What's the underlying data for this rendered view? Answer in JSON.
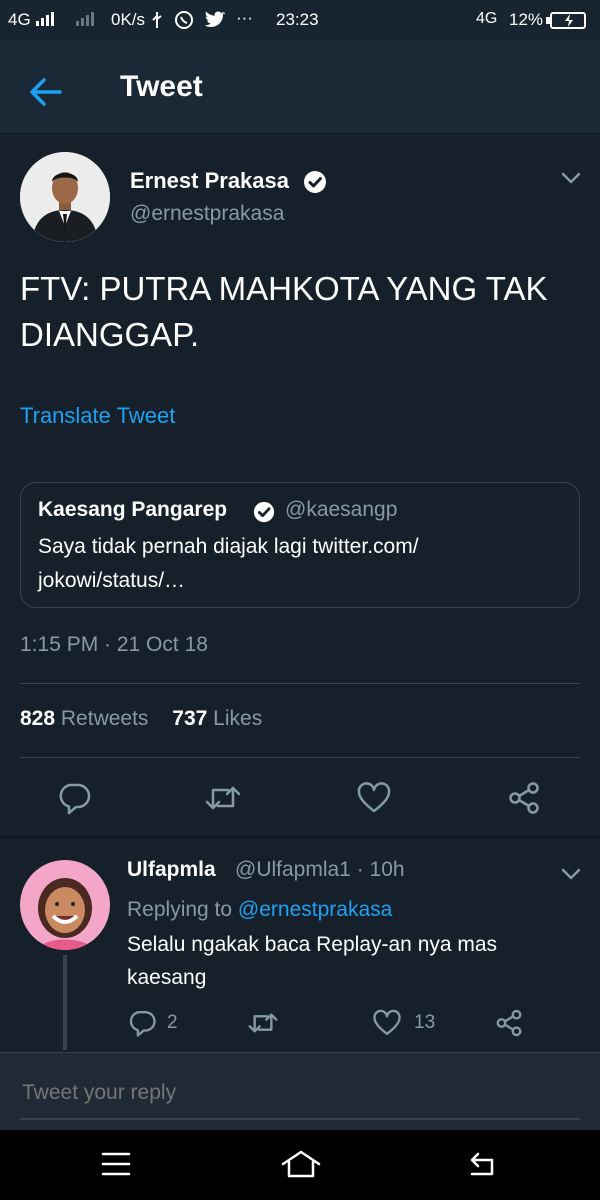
{
  "status_bar": {
    "network1": "4G",
    "network2": "4G",
    "speed": "0K/s",
    "dots": "···",
    "time": "23:23",
    "battery": "12%"
  },
  "header": {
    "title": "Tweet"
  },
  "tweet": {
    "author_name": "Ernest Prakasa",
    "author_handle": "@ernestprakasa",
    "text_line1": "FTV: PUTRA MAHKOTA YANG TAK",
    "text_line2": "DIANGGAP.",
    "translate": "Translate Tweet",
    "quote": {
      "name": "Kaesang Pangarep",
      "handle": "@kaesangp",
      "text_line1": "Saya tidak pernah diajak lagi twitter.com/",
      "text_line2": "jokowi/status/…"
    },
    "timestamp": "1:15 PM · 21 Oct 18",
    "retweets_count": "828",
    "retweets_label": "Retweets",
    "likes_count": "737",
    "likes_label": "Likes"
  },
  "reply": {
    "name": "Ulfapmla",
    "handle_time": "@Ulfapmla1 · 10h",
    "replying_prefix": "Replying to",
    "replying_handle": "@ernestprakasa",
    "text_line1": "Selalu ngakak baca Replay-an nya mas",
    "text_line2": "kaesang",
    "reply_count": "2",
    "like_count": "13"
  },
  "compose": {
    "placeholder": "Tweet your reply"
  },
  "colors": {
    "accent": "#1da1f2",
    "background": "#15202b",
    "muted": "#8899a6"
  },
  "icons": [
    "back-arrow-icon",
    "verified-icon",
    "chevron-down-icon",
    "comment-icon",
    "retweet-icon",
    "heart-icon",
    "share-icon",
    "menu-icon",
    "home-icon",
    "back-nav-icon"
  ]
}
